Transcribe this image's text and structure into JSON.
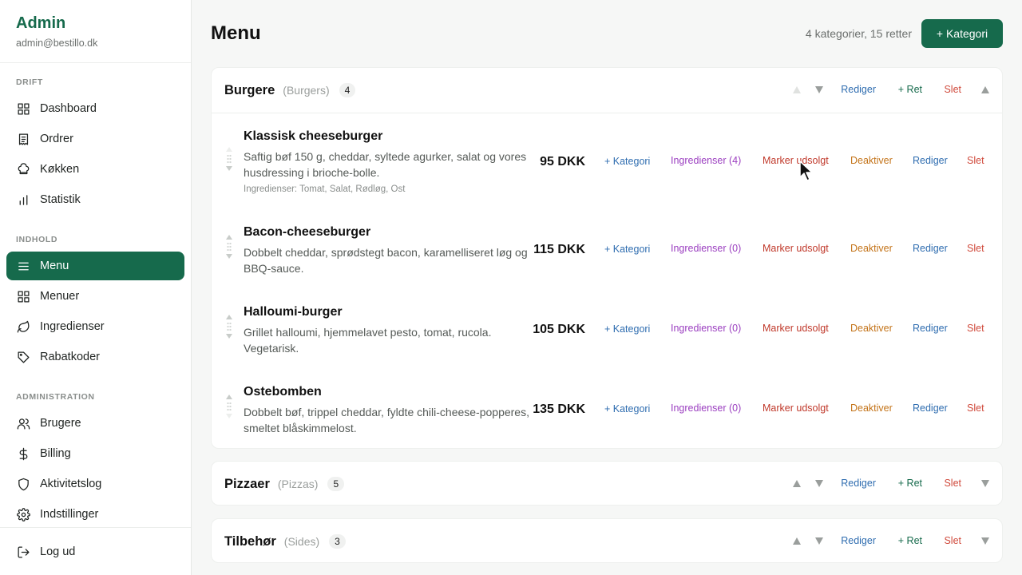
{
  "sidebar": {
    "title": "Admin",
    "email": "admin@bestillo.dk",
    "sections": {
      "drift": "DRIFT",
      "indhold": "INDHOLD",
      "administration": "ADMINISTRATION"
    },
    "items": {
      "dashboard": "Dashboard",
      "ordrer": "Ordrer",
      "kokken": "Køkken",
      "statistik": "Statistik",
      "menu": "Menu",
      "menuer": "Menuer",
      "ingredienser": "Ingredienser",
      "rabatkoder": "Rabatkoder",
      "brugere": "Brugere",
      "billing": "Billing",
      "aktivitetslog": "Aktivitetslog",
      "indstillinger": "Indstillinger"
    },
    "logout": "Log ud"
  },
  "header": {
    "title": "Menu",
    "summary": "4 kategorier, 15 retter",
    "add_category": "+ Kategori"
  },
  "actions": {
    "edit": "Rediger",
    "add_dish": "+ Ret",
    "delete": "Slet",
    "add_category": "+ Kategori",
    "mark_sold_out": "Marker udsolgt",
    "deactivate": "Deaktiver"
  },
  "categories": [
    {
      "name": "Burgere",
      "sub": "(Burgers)",
      "count": "4",
      "items": [
        {
          "name": "Klassisk cheeseburger",
          "desc": "Saftig bøf 150 g, cheddar, syltede agurker, salat og vores husdressing i brioche-bolle.",
          "ingredients": "Ingredienser: Tomat, Salat, Rødløg, Ost",
          "price": "95 DKK",
          "ing_label": "Ingredienser (4)"
        },
        {
          "name": "Bacon-cheeseburger",
          "desc": "Dobbelt cheddar, sprødstegt bacon, karamelliseret løg og BBQ-sauce.",
          "price": "115 DKK",
          "ing_label": "Ingredienser (0)"
        },
        {
          "name": "Halloumi-burger",
          "desc": "Grillet halloumi, hjemmelavet pesto, tomat, rucola. Vegetarisk.",
          "price": "105 DKK",
          "ing_label": "Ingredienser (0)"
        },
        {
          "name": "Ostebomben",
          "desc": "Dobbelt bøf, trippel cheddar, fyldte chili-cheese-popperes, smeltet blåskimmelost.",
          "price": "135 DKK",
          "ing_label": "Ingredienser (0)"
        }
      ]
    },
    {
      "name": "Pizzaer",
      "sub": "(Pizzas)",
      "count": "5"
    },
    {
      "name": "Tilbehør",
      "sub": "(Sides)",
      "count": "3"
    }
  ],
  "colors": {
    "accent": "#166a4c",
    "link_blue": "#2f6db0",
    "purple": "#9b3fc0",
    "red": "#c0392b",
    "orange": "#c4741a"
  }
}
